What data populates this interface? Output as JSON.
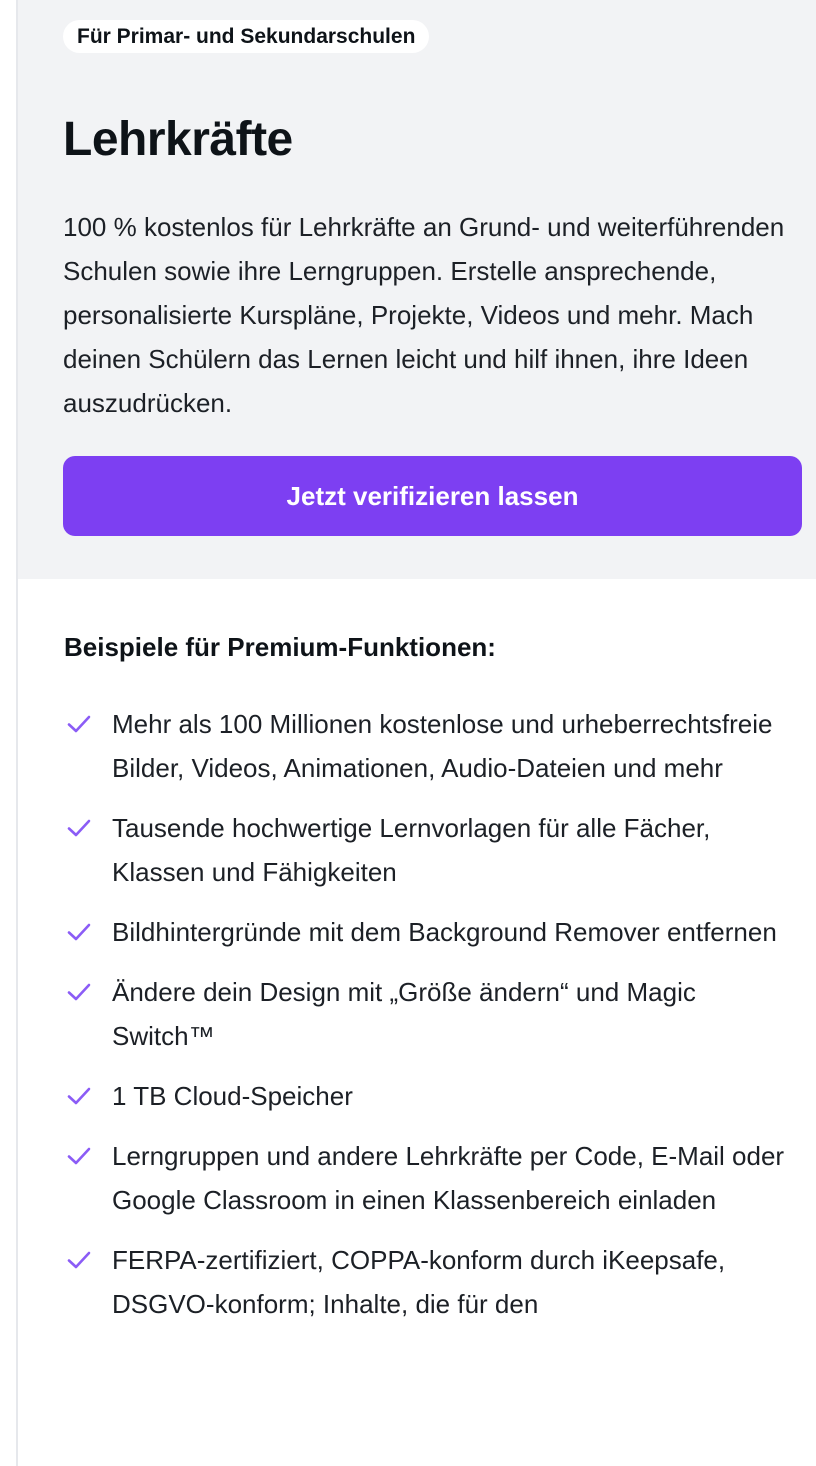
{
  "hero": {
    "badge": "Für Primar- und Sekundarschulen",
    "title": "Lehrkräfte",
    "description": "100 % kostenlos für Lehrkräfte an Grund- und weiterführenden Schulen sowie ihre Lerngruppen. Erstelle ansprechende, personalisierte Kurspläne, Projekte, Videos und mehr. Mach deinen Schülern das Lernen leicht und hilf ihnen, ihre Ideen auszudrücken.",
    "cta_label": "Jetzt verifizieren lassen"
  },
  "features": {
    "heading": "Beispiele für Premium-Funktionen:",
    "check_icon": "check-icon",
    "items": [
      "Mehr als 100 Millionen kostenlose und urheberrechtsfreie Bilder, Videos, Animationen, Audio-Dateien und mehr",
      "Tausende hochwertige Lernvorlagen für alle Fächer, Klassen und Fähigkeiten",
      "Bildhintergründe mit dem Background Remover entfernen",
      "Ändere dein Design mit „Größe ändern“ und Magic Switch™",
      "1 TB Cloud-Speicher",
      "Lerngruppen und andere Lehrkräfte per Code, E-Mail oder Google Classroom in einen Klassenbereich einladen",
      "FERPA-zertifiziert, COPPA-konform durch iKeepsafe, DSGVO-konform; Inhalte, die für den"
    ]
  },
  "colors": {
    "accent": "#7d3ff2",
    "check": "#8b5cf6",
    "hero_background": "#f2f3f5",
    "text": "#0e1318"
  }
}
